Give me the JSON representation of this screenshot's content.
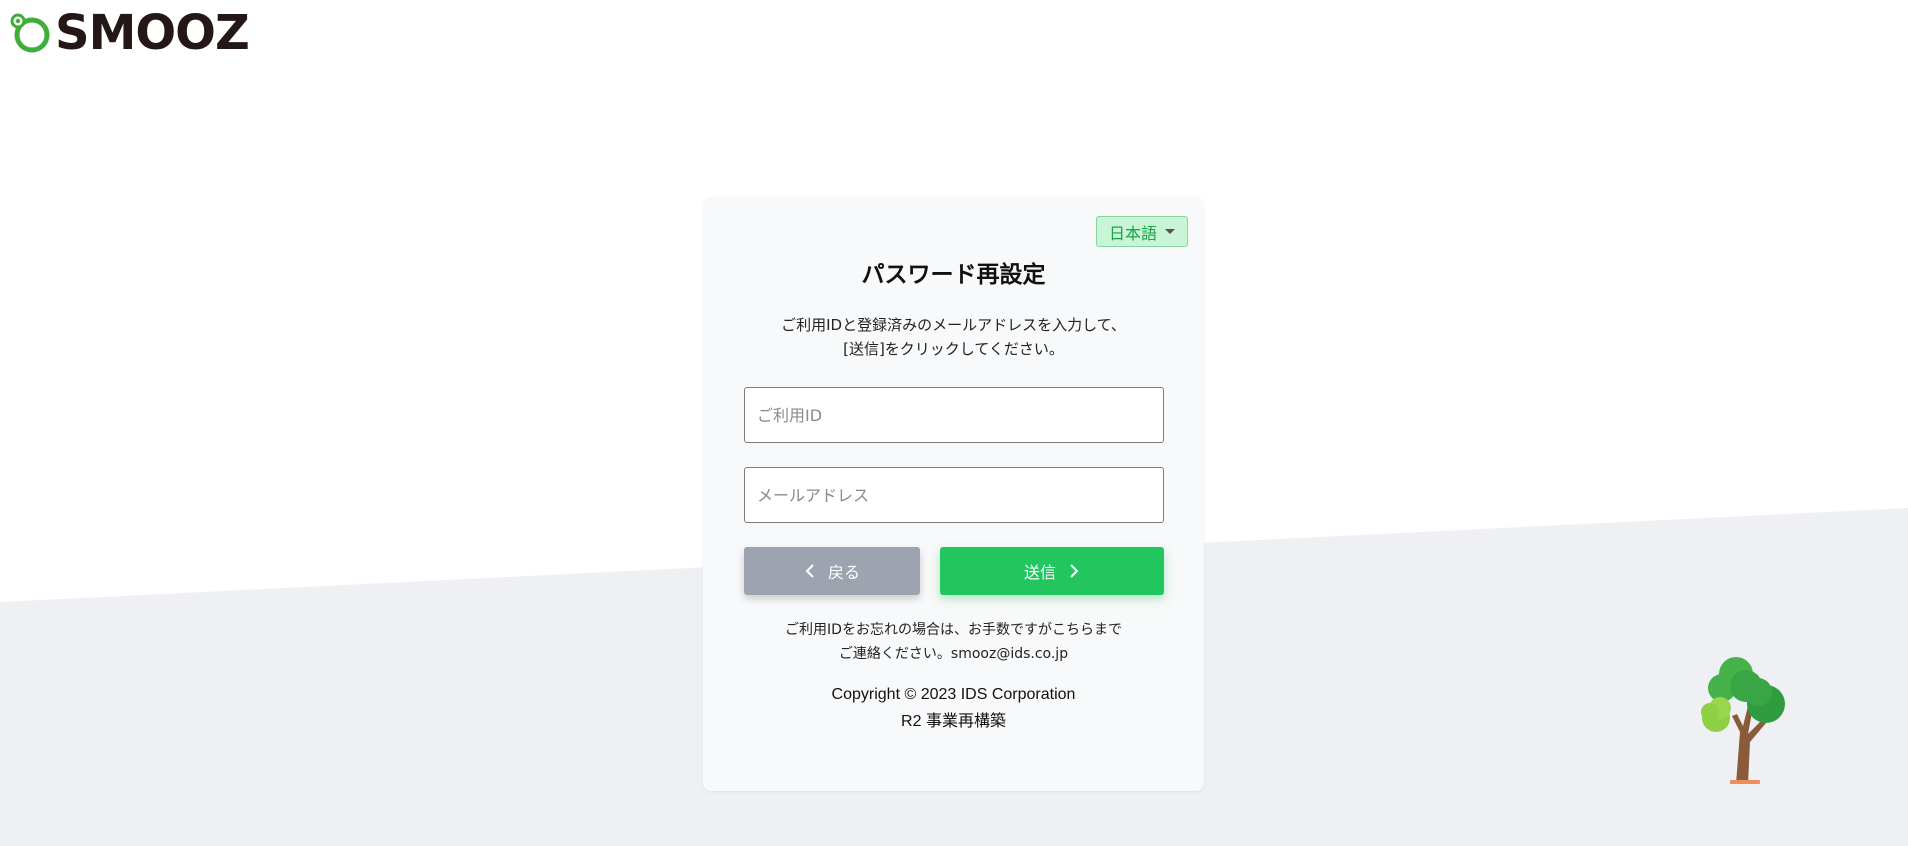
{
  "brand": {
    "name": "SMOOZ"
  },
  "language": {
    "selected": "日本語"
  },
  "form": {
    "title": "パスワード再設定",
    "description_line1": "ご利用IDと登録済みのメールアドレスを入力して、",
    "description_line2": "[送信]をクリックしてください。",
    "user_id_placeholder": "ご利用ID",
    "email_placeholder": "メールアドレス",
    "back_label": "戻る",
    "send_label": "送信"
  },
  "footer": {
    "note_line1": "ご利用IDをお忘れの場合は、お手数ですがこちらまで",
    "note_line2": "ご連絡ください。smooz@ids.co.jp",
    "copyright": "Copyright © 2023 IDS Corporation",
    "version": "R2 事業再構築"
  },
  "colors": {
    "accent": "#22c55e",
    "back_button": "#9ea4af",
    "lang_bg": "#c9f4d5",
    "background_lower": "#eef0f4"
  },
  "icons": [
    "smooz-logo-icon",
    "chevron-down-icon",
    "chevron-left-icon",
    "chevron-right-icon",
    "tree-illustration-icon"
  ]
}
